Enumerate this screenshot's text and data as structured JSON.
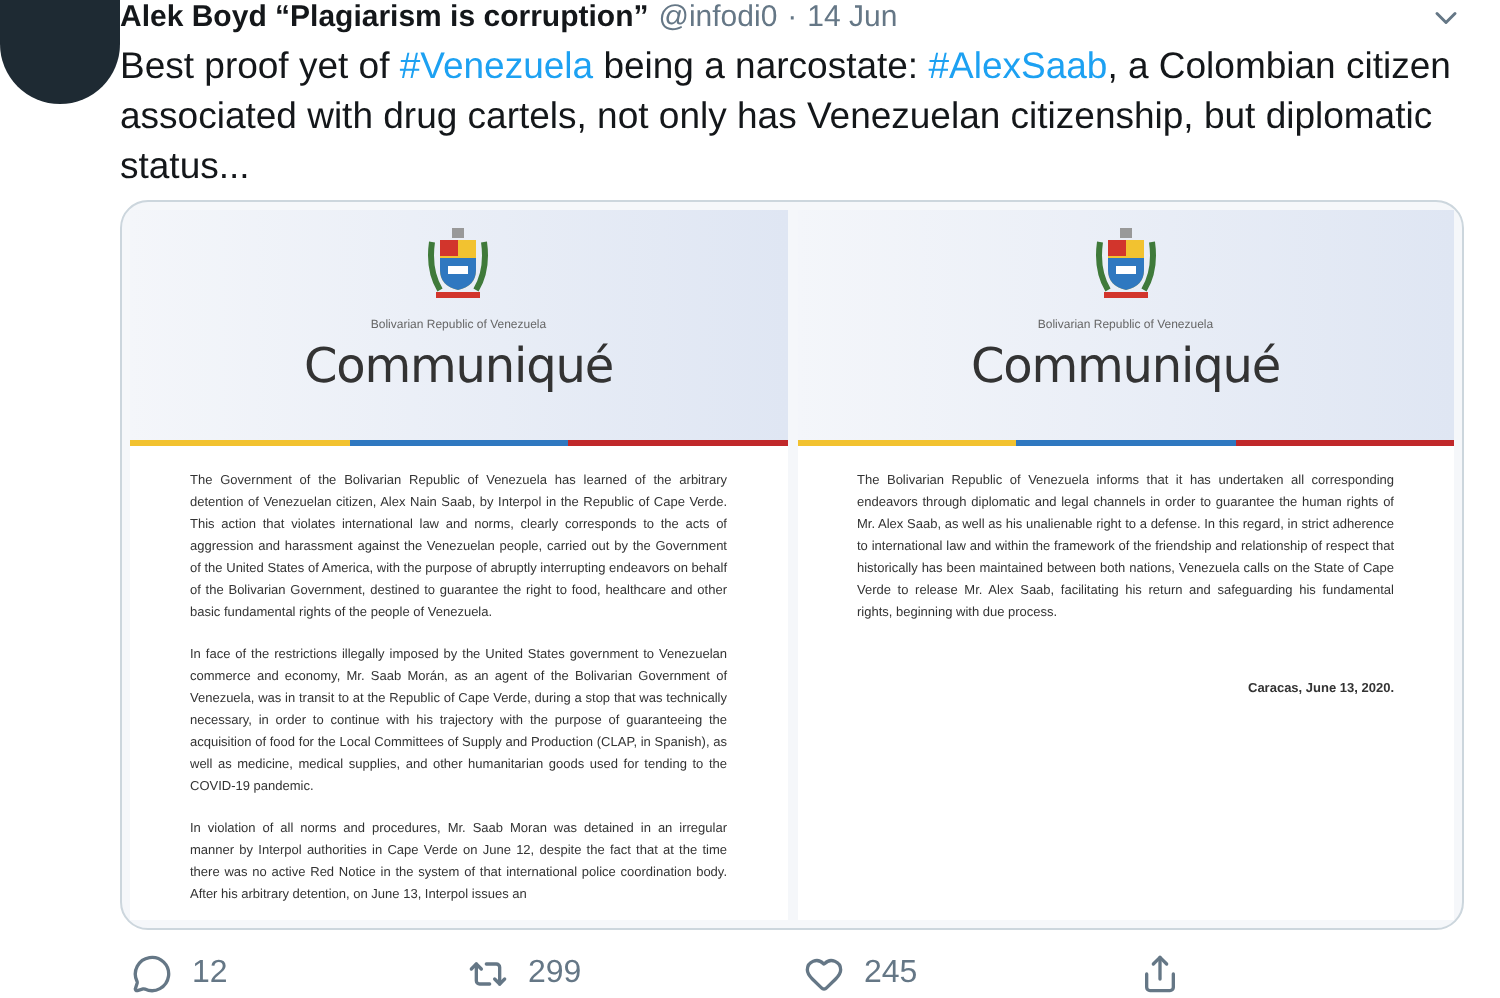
{
  "tweet": {
    "author": "Alek Boyd “Plagiarism is corruption”",
    "handle": "@infodi0",
    "separator": "·",
    "date": "14 Jun",
    "text": [
      {
        "kind": "plain",
        "text": "Best proof yet of "
      },
      {
        "kind": "hashtag",
        "text": "#Venezuela"
      },
      {
        "kind": "plain",
        "text": " being a narcostate: "
      },
      {
        "kind": "hashtag",
        "text": "#AlexSaab"
      },
      {
        "kind": "plain",
        "text": ", a Colombian citizen associated with drug cartels, not only has Venezuelan citizenship, but diplomatic status..."
      }
    ]
  },
  "card": {
    "documents": [
      {
        "org": "Bolivarian Republic of Venezuela",
        "title": "Communiqué",
        "paragraphs": [
          "The Government of the Bolivarian Republic of Venezuela has learned of the arbitrary detention of Venezuelan citizen, Alex Nain Saab, by Interpol in the Republic of Cape Verde. This action that violates international law and norms, clearly corresponds to the acts of aggression and harassment against the Venezuelan people, carried out by the Government of the United States of America, with the purpose of abruptly interrupting endeavors on behalf of the Bolivarian Government, destined to guarantee the right to food, healthcare and other basic fundamental rights of the people of Venezuela.",
          "In face of the restrictions illegally imposed by the United States government to Venezuelan commerce and economy, Mr. Saab Morán, as an agent of the Bolivarian Government of Venezuela, was in transit to at the Republic of Cape Verde, during a stop that was technically necessary, in order to continue with his trajectory with the purpose of guaranteeing the acquisition of food for the Local Committees of Supply and Production (CLAP, in Spanish), as well as medicine, medical supplies, and other humanitarian goods used for tending to the COVID-19 pandemic.",
          "In violation of all norms and procedures, Mr. Saab Moran was detained in an irregular manner by Interpol authorities in Cape Verde on June 12, despite the fact that at the time there was no active Red Notice in the system of that international police coordination body. After his arbitrary detention, on June 13, Interpol issues an"
        ]
      },
      {
        "org": "Bolivarian Republic of Venezuela",
        "title": "Communiqué",
        "paragraphs": [
          "The Bolivarian Republic of Venezuela informs that it has undertaken all corresponding endeavors through diplomatic and legal channels in order to guarantee the human rights of Mr. Alex Saab, as well as his unalienable right to a defense. In this regard, in strict adherence to international law and within the framework of the friendship and relationship of respect that historically has been maintained between both nations, Venezuela calls on the State of Cape Verde to release Mr. Alex Saab, facilitating his return and safeguarding his fundamental rights, beginning with due process."
        ],
        "signoff": "Caracas, June 13, 2020."
      }
    ]
  },
  "actions": [
    {
      "kind": "reply",
      "count": "12"
    },
    {
      "kind": "retweet",
      "count": "299"
    },
    {
      "kind": "like",
      "count": "245"
    },
    {
      "kind": "share"
    }
  ]
}
